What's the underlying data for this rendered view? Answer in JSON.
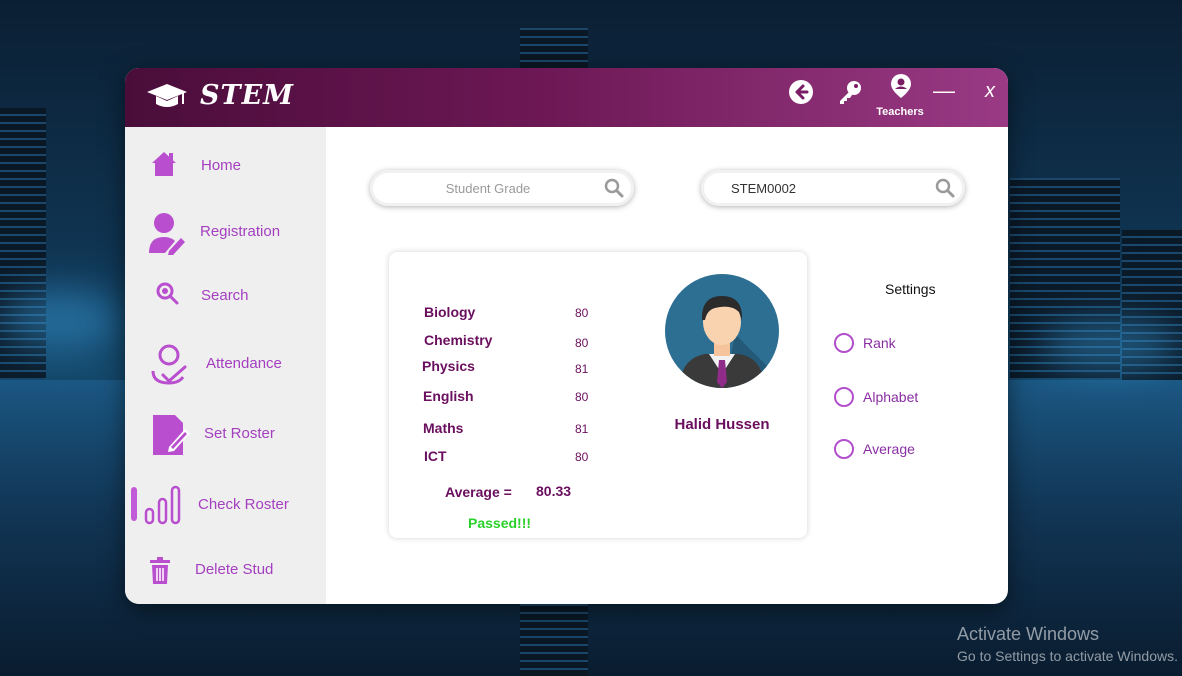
{
  "app": {
    "name": "STEM",
    "user_label": "Teachers",
    "minimize": "—",
    "close": "x"
  },
  "sidebar": {
    "items": [
      {
        "label": "Home",
        "icon": "home-icon"
      },
      {
        "label": "Registration",
        "icon": "user-edit-icon"
      },
      {
        "label": "Search",
        "icon": "search-icon"
      },
      {
        "label": "Attendance",
        "icon": "attendance-icon"
      },
      {
        "label": "Set Roster",
        "icon": "edit-document-icon"
      },
      {
        "label": "Check Roster",
        "icon": "bar-chart-icon"
      },
      {
        "label": "Delete Stud",
        "icon": "trash-icon"
      }
    ],
    "active_index": 5
  },
  "search": {
    "grade_placeholder": "Student Grade",
    "id_value": "STEM0002"
  },
  "grades": {
    "subjects": [
      {
        "name": "Biology",
        "score": "80"
      },
      {
        "name": "Chemistry",
        "score": "80"
      },
      {
        "name": "Physics",
        "score": "81"
      },
      {
        "name": "English",
        "score": "80"
      },
      {
        "name": "Maths",
        "score": "81"
      },
      {
        "name": "ICT",
        "score": "80"
      }
    ],
    "average_label": "Average  =",
    "average_value": "80.33",
    "status": "Passed!!!"
  },
  "student": {
    "name": "Halid Hussen"
  },
  "settings": {
    "title": "Settings",
    "options": [
      "Rank",
      "Alphabet",
      "Average"
    ]
  },
  "watermark": {
    "line1": "Activate Windows",
    "line2": "Go to Settings to activate Windows."
  },
  "colors": {
    "titlebar_start": "#4a0d3a",
    "titlebar_end": "#9a3a85",
    "accent_purple": "#a43fc0",
    "text_dark_purple": "#6a0e5e",
    "pass_green": "#2bd12b"
  }
}
